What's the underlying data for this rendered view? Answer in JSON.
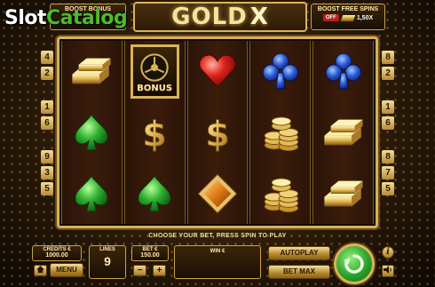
{
  "watermark": {
    "part1": "Slot",
    "part2": "Catalog"
  },
  "header": {
    "boost_bonus_label": "BOOST BONUS",
    "logo_text": "GOLD",
    "logo_x": "X",
    "boost_free_spins_label": "BOOST FREE SPINS",
    "free_spins_toggle": "OFF",
    "free_spins_multiplier": "1,50X"
  },
  "paylines": {
    "left": [
      "4",
      "2",
      "1",
      "6",
      "9",
      "3",
      "5"
    ],
    "right": [
      "8",
      "2",
      "1",
      "6",
      "8",
      "7",
      "5"
    ]
  },
  "reels": [
    [
      "gold-bar",
      "clover",
      "clover"
    ],
    [
      "bonus-safe",
      "dollar",
      "clover"
    ],
    [
      "heart",
      "dollar",
      "diamond"
    ],
    [
      "club",
      "coins",
      "coins"
    ],
    [
      "club",
      "gold-bar",
      "gold-bar"
    ]
  ],
  "bonus_label": "BONUS",
  "hint": "CHOOSE YOUR BET, PRESS SPIN TO PLAY",
  "controls": {
    "credits_label": "CREDITS €",
    "credits_value": "1000.00",
    "menu_label": "MENU",
    "lines_label": "LINES",
    "lines_value": "9",
    "bet_label": "BET €",
    "bet_value": "150.00",
    "minus": "−",
    "plus": "+",
    "win_label": "WIN €",
    "autoplay_label": "AUTOPLAY",
    "betmax_label": "BET MAX",
    "info": "i"
  },
  "colors": {
    "gold": "#d9b35a",
    "spin_green": "#2aa22a",
    "clover_green": "#2fae2f",
    "heart_red": "#e0241c",
    "club_blue": "#2b5bd6"
  }
}
